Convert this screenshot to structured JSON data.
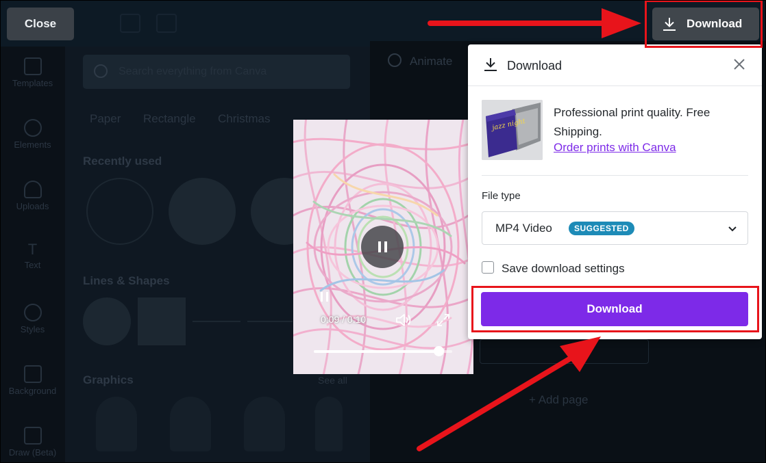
{
  "topbar": {
    "close_label": "Close",
    "download_label": "Download"
  },
  "left_rail": {
    "items": [
      {
        "label": "Templates",
        "icon": "templates-icon"
      },
      {
        "label": "Elements",
        "icon": "elements-icon"
      },
      {
        "label": "Uploads",
        "icon": "uploads-icon"
      },
      {
        "label": "Text",
        "icon": "text-icon"
      },
      {
        "label": "Styles",
        "icon": "styles-icon"
      },
      {
        "label": "Background",
        "icon": "background-icon"
      },
      {
        "label": "Draw (Beta)",
        "icon": "draw-icon"
      }
    ]
  },
  "side_panel": {
    "search_placeholder": "Search everything from Canva",
    "chips": [
      "Paper",
      "Rectangle",
      "Christmas"
    ],
    "recently_used_title": "Recently used",
    "lines_shapes_title": "Lines & Shapes",
    "graphics_title": "Graphics",
    "see_all": "See all"
  },
  "canvas": {
    "animate_label": "Animate",
    "add_page_label": "+ Add page"
  },
  "video": {
    "timecode": "0:09 / 0:10",
    "progress_fraction": 0.9
  },
  "download_panel": {
    "title": "Download",
    "promo_text": "Professional print quality. Free Shipping.",
    "promo_link": "Order prints with Canva",
    "promo_thumb_text": "jazz night",
    "file_type_label": "File type",
    "file_type_value": "MP4 Video",
    "suggested_badge": "SUGGESTED",
    "save_settings_label": "Save download settings",
    "download_button": "Download"
  },
  "colors": {
    "accent_purple": "#7d2ae8",
    "badge_blue": "#1d8bb7",
    "annotation_red": "#e8141b"
  }
}
